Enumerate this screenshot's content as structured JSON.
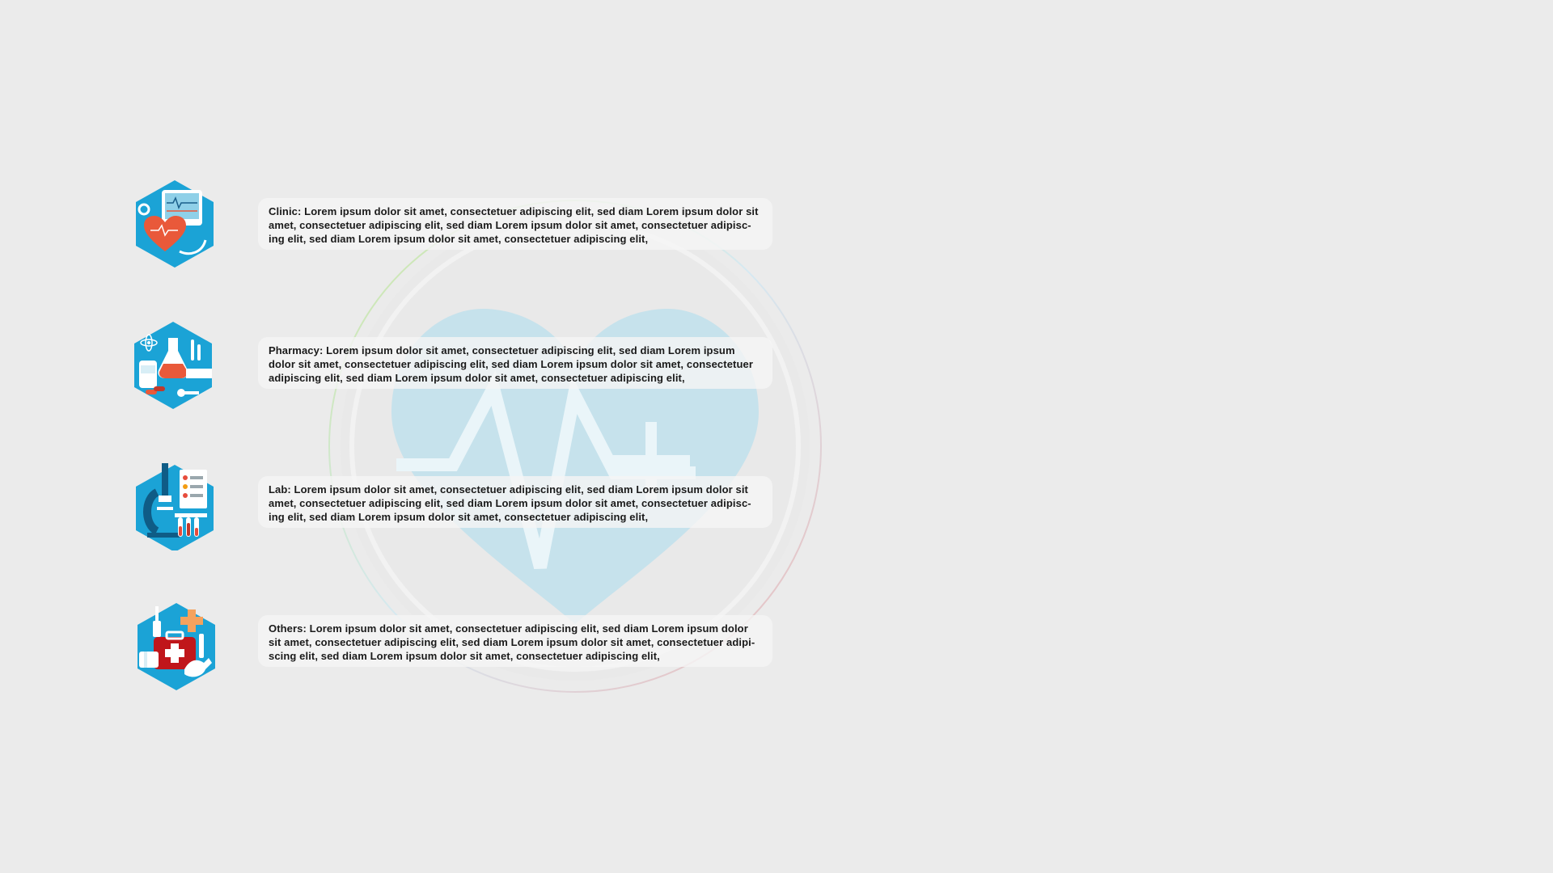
{
  "slide": {
    "background": "#ebebeb",
    "accent": "#1ba3d6",
    "emblem": {
      "icon": "heartbeat-cross-heart",
      "color": "#9fd3e4"
    },
    "sections": [
      {
        "id": "clinic",
        "icon": "clinic-monitor-heart-icon",
        "title": "Clinic:",
        "body": " Lorem ipsum dolor sit amet, consectetuer adipiscing elit, sed diam Lorem ipsum dolor sit amet, consectetuer adipiscing elit, sed diam Lorem ipsum dolor sit amet, consectetuer adipisc-ing elit, sed diam Lorem ipsum dolor sit amet, consectetuer adipiscing elit,"
      },
      {
        "id": "pharmacy",
        "icon": "pharmacy-flask-pills-icon",
        "title": "Pharmacy:",
        "body": " Lorem ipsum dolor sit amet, consectetuer adipiscing elit, sed diam Lorem ipsum dolor sit amet, consectetuer adipiscing elit, sed diam Lorem ipsum dolor sit amet, consectetuer adipiscing elit, sed diam Lorem ipsum dolor sit amet, consectetuer adipiscing elit,"
      },
      {
        "id": "lab",
        "icon": "lab-microscope-icon",
        "title": "Lab:",
        "body": " Lorem ipsum dolor sit amet, consectetuer adipiscing elit, sed diam Lorem ipsum dolor sit amet, consectetuer adipiscing elit, sed diam Lorem ipsum dolor sit amet, consectetuer adipisc-ing elit, sed diam Lorem ipsum dolor sit amet, consectetuer adipiscing elit,"
      },
      {
        "id": "others",
        "icon": "first-aid-kit-icon",
        "title": "Others:",
        "body": " Lorem ipsum dolor sit amet, consectetuer adipiscing elit, sed diam Lorem ipsum dolor sit amet, consectetuer adipiscing elit, sed diam Lorem ipsum dolor sit amet, consectetuer adipi-scing elit, sed diam Lorem ipsum dolor sit amet, consectetuer adipiscing elit,"
      }
    ]
  }
}
